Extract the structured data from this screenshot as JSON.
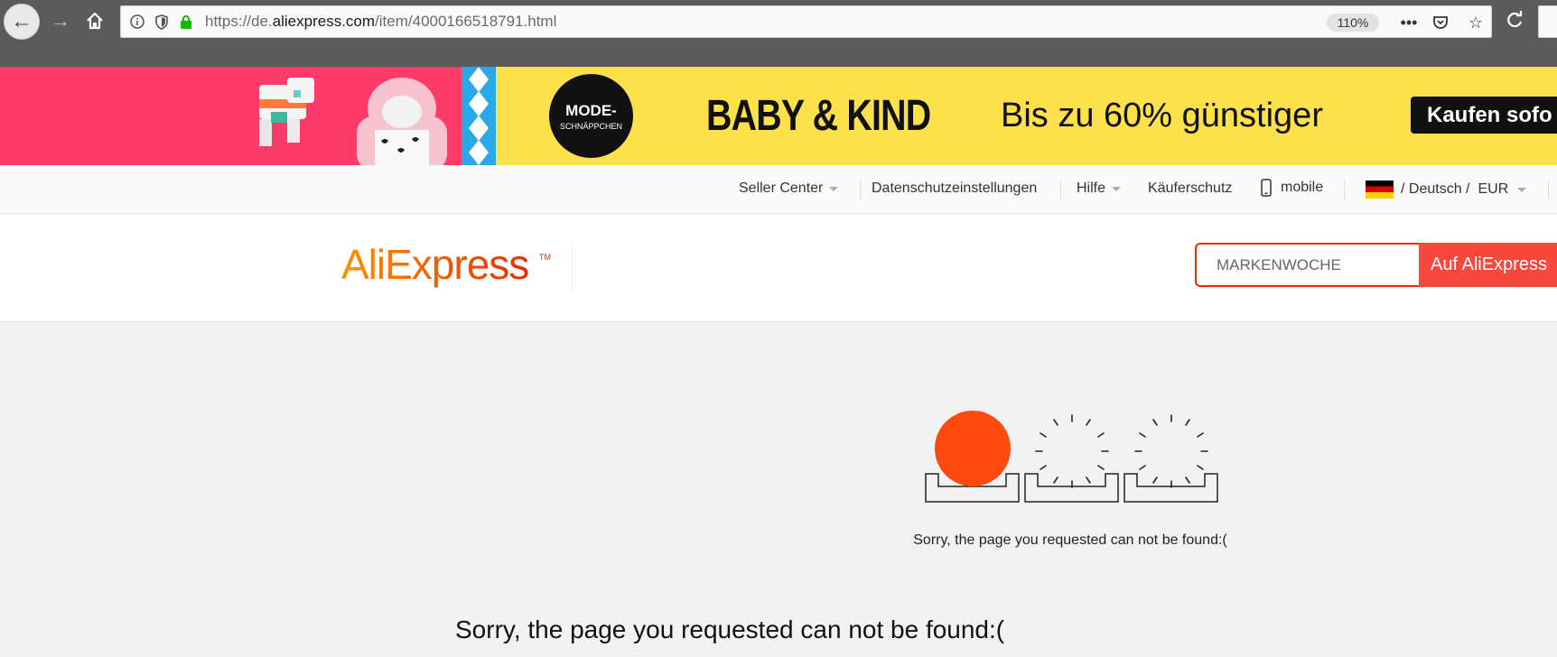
{
  "browser": {
    "url_prefix": "https://de.",
    "url_domain": "aliexpress.com",
    "url_path": "/item/4000166518791.html",
    "zoom": "110%",
    "icons": [
      "back-icon",
      "forward-icon",
      "home-icon",
      "info-icon",
      "shield-icon",
      "lock-icon",
      "more-icon",
      "pocket-icon",
      "star-icon",
      "reload-icon"
    ]
  },
  "banner": {
    "badge_line1": "MODE-",
    "badge_line2": "SCHNÄPPCHEN",
    "title": "BABY & KIND",
    "subtitle": "Bis zu 60% günstiger",
    "cta": "Kaufen sofo"
  },
  "topnav": {
    "seller_center": "Seller Center",
    "privacy": "Datenschutzeinstellungen",
    "help": "Hilfe",
    "buyer_protection": "Käuferschutz",
    "mobile": "mobile",
    "language": "/ Deutsch /",
    "currency": "EUR"
  },
  "header": {
    "logo": "AliExpress",
    "logo_tm": "TM",
    "search_placeholder": "MARKENWOCHE",
    "search_button": "Auf AliExpress"
  },
  "main": {
    "error_small": "Sorry, the page you requested can not be found:(",
    "error_large": "Sorry, the page you requested can not be found:("
  },
  "colors": {
    "accent": "#e62e04",
    "search_button": "#f8473d",
    "sun": "#ff4a0f",
    "banner_yellow": "#fde14b",
    "banner_pink": "#fd3b6a"
  }
}
